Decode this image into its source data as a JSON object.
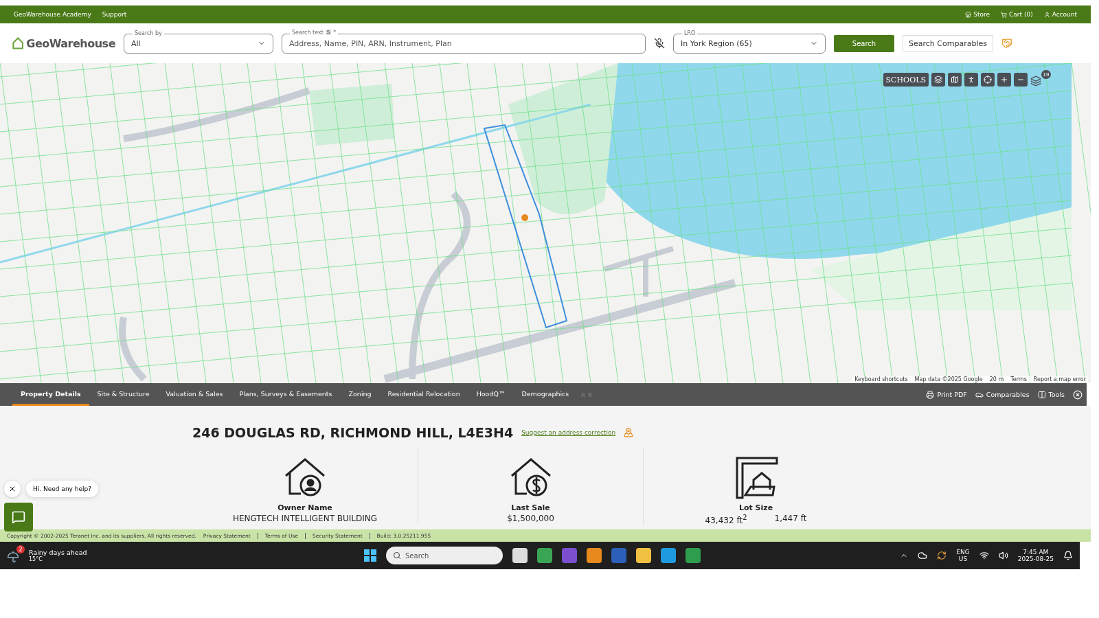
{
  "top_bar": {
    "links": [
      "GeoWarehouse Academy",
      "Support"
    ],
    "account_links": [
      {
        "kind": "store",
        "label": "Store"
      },
      {
        "kind": "cart",
        "label": "Cart (0)"
      },
      {
        "kind": "account",
        "label": "Account"
      }
    ]
  },
  "header": {
    "logo": "GeoWarehouse",
    "search_by": {
      "label": "Search by",
      "value": "All"
    },
    "search_text": {
      "label": "Search text",
      "badge": "S",
      "required": "*",
      "placeholder": "Address, Name, PIN, ARN, Instrument, Plan"
    },
    "lro": {
      "label": "LRO",
      "value": "In York Region (65)"
    },
    "search_button": "Search",
    "comparables_button": "Search Comparables"
  },
  "map": {
    "schools_button": "SCHOOLS",
    "layers_badge": "19",
    "attribution": [
      "Keyboard shortcuts",
      "Map data ©2025 Google",
      "20 m",
      "Terms",
      "Report a map error"
    ]
  },
  "tabs": [
    {
      "label": "Property Details",
      "selected": true
    },
    {
      "label": "Site & Structure",
      "selected": false
    },
    {
      "label": "Valuation & Sales",
      "selected": false
    },
    {
      "label": "Plans, Surveys & Easements",
      "selected": false
    },
    {
      "label": "Zoning",
      "selected": false
    },
    {
      "label": "Residential Relocation",
      "selected": false
    },
    {
      "label": "HoodQ™",
      "selected": false
    },
    {
      "label": "Demographics",
      "selected": false
    }
  ],
  "tab_actions": [
    {
      "kind": "print",
      "label": "Print PDF"
    },
    {
      "kind": "comparables",
      "label": "Comparables"
    },
    {
      "kind": "tools",
      "label": "Tools"
    }
  ],
  "details": {
    "address": "246 DOUGLAS RD, RICHMOND HILL, L4E3H4",
    "suggest_link": "Suggest an address correction",
    "cards": [
      {
        "kind": "owner",
        "label": "Owner Name",
        "values": [
          "HENGTECH INTELLIGENT BUILDING"
        ]
      },
      {
        "kind": "sale",
        "label": "Last Sale",
        "values": [
          "$1,500,000"
        ]
      },
      {
        "kind": "lot",
        "label": "Lot Size",
        "values": [
          "43,432 ft$^{2}$",
          "1,447 ft"
        ]
      }
    ]
  },
  "chat": {
    "greeting": "Hi. Need any help?"
  },
  "footer": {
    "copyright": "Copyright © 2002-2025 Teranet Inc. and its suppliers. All rights reserved.",
    "links": [
      "Privacy Statement",
      "Terms of Use",
      "Security Statement"
    ],
    "build": "Build: 3.0.25211.955"
  },
  "taskbar": {
    "weather_badge": "2",
    "weather_title": "Rainy days ahead",
    "weather_temp": "15°C",
    "search_placeholder": "Search",
    "language": "ENG",
    "region": "US",
    "time": "7:45 AM",
    "date": "2025-08-25"
  }
}
